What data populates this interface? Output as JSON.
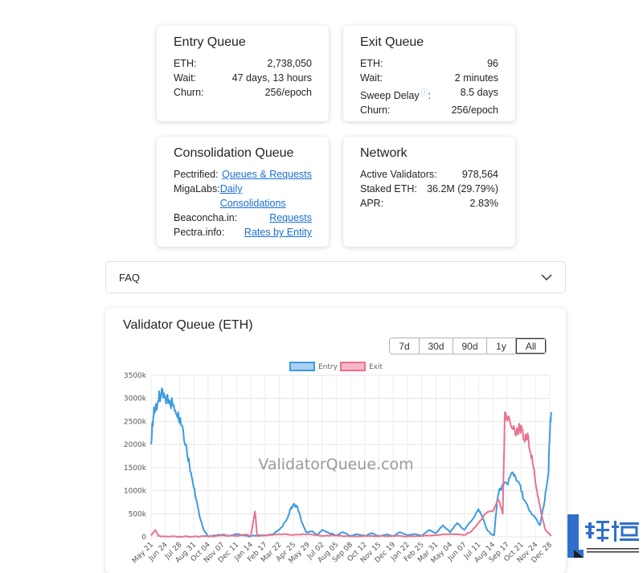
{
  "cards": {
    "entry": {
      "title": "Entry Queue",
      "rows": [
        {
          "key": "ETH:",
          "value": "2,738,050"
        },
        {
          "key": "Wait:",
          "value": "47 days, 13 hours"
        },
        {
          "key": "Churn:",
          "value": "256/epoch"
        }
      ]
    },
    "exit": {
      "title": "Exit Queue",
      "rows": [
        {
          "key": "ETH:",
          "value": "96"
        },
        {
          "key": "Wait:",
          "value": "2 minutes"
        },
        {
          "key": "Sweep Delay",
          "colon": ":",
          "value": "8.5 days",
          "info_icon": "info-circle-icon"
        },
        {
          "key": "Churn:",
          "value": "256/epoch"
        }
      ]
    },
    "consolidation": {
      "title": "Consolidation Queue",
      "rows": [
        {
          "key": "Pectrified:",
          "link": "Queues & Requests"
        },
        {
          "key": "MigaLabs:",
          "link_line1": "Daily",
          "link_line2": "Consolidations"
        },
        {
          "key": "Beaconcha.in:",
          "link": "Requests"
        },
        {
          "key": "Pectra.info:",
          "link": "Rates by Entity"
        }
      ]
    },
    "network": {
      "title": "Network",
      "rows": [
        {
          "key": "Active Validators:",
          "value": "978,564"
        },
        {
          "key": "Staked ETH:",
          "value": "36.2M (29.79%)"
        },
        {
          "key": "APR:",
          "value": "2.83%"
        }
      ]
    }
  },
  "faq": {
    "label": "FAQ",
    "icon": "chevron-down-icon"
  },
  "chart_card": {
    "title": "Validator Queue (ETH)",
    "ranges": [
      "7d",
      "30d",
      "90d",
      "1y",
      "All"
    ],
    "active_range": "All"
  },
  "chart_data": {
    "type": "line",
    "title": "",
    "watermark": "ValidatorQueue.com",
    "xlabel": "",
    "ylabel": "",
    "ylim": [
      0,
      3500000
    ],
    "ytick_labels": [
      "0",
      "500k",
      "1000k",
      "1500k",
      "2000k",
      "2500k",
      "3000k",
      "3500k"
    ],
    "xtick_labels": [
      "May 21",
      "Jun 24",
      "Jul 28",
      "Aug 31",
      "Oct 04",
      "Nov 07",
      "Dec 11",
      "Jan 14",
      "Feb 17",
      "Mar 22",
      "Apr 25",
      "May 29",
      "Jul 02",
      "Aug 05",
      "Sep 08",
      "Oct 12",
      "Nov 15",
      "Dec 19",
      "Jan 22",
      "Feb 25",
      "Mar 31",
      "May 04",
      "Jun 07",
      "Jul 11",
      "Aug 14",
      "Sep 17",
      "Oct 21",
      "Nov 24",
      "Dec 28"
    ],
    "legend": {
      "placement": "top-center"
    },
    "grid": true,
    "series": [
      {
        "name": "Entry",
        "color": "#3d9be0",
        "values": [
          [
            0,
            2000000
          ],
          [
            0.15,
            2600000
          ],
          [
            0.3,
            2800000
          ],
          [
            0.5,
            2950000
          ],
          [
            0.7,
            3050000
          ],
          [
            1.0,
            3000000
          ],
          [
            1.3,
            2950000
          ],
          [
            1.6,
            2850000
          ],
          [
            1.9,
            2700000
          ],
          [
            2.2,
            2400000
          ],
          [
            2.5,
            1900000
          ],
          [
            2.8,
            1400000
          ],
          [
            3.1,
            900000
          ],
          [
            3.4,
            450000
          ],
          [
            3.7,
            150000
          ],
          [
            4.0,
            10000
          ],
          [
            4.5,
            30000
          ],
          [
            5.0,
            50000
          ],
          [
            5.5,
            20000
          ],
          [
            6.0,
            60000
          ],
          [
            6.5,
            30000
          ],
          [
            7.0,
            10000
          ],
          [
            7.5,
            40000
          ],
          [
            8.0,
            30000
          ],
          [
            8.5,
            50000
          ],
          [
            9.0,
            150000
          ],
          [
            9.5,
            350000
          ],
          [
            9.8,
            600000
          ],
          [
            10.0,
            700000
          ],
          [
            10.3,
            620000
          ],
          [
            10.6,
            300000
          ],
          [
            10.9,
            100000
          ],
          [
            11.3,
            120000
          ],
          [
            11.7,
            40000
          ],
          [
            12.0,
            150000
          ],
          [
            12.5,
            80000
          ],
          [
            13.0,
            30000
          ],
          [
            13.5,
            100000
          ],
          [
            14.0,
            20000
          ],
          [
            14.5,
            60000
          ],
          [
            15.0,
            20000
          ],
          [
            15.5,
            80000
          ],
          [
            16.0,
            10000
          ],
          [
            16.5,
            50000
          ],
          [
            17.0,
            20000
          ],
          [
            17.5,
            100000
          ],
          [
            18.0,
            30000
          ],
          [
            18.5,
            60000
          ],
          [
            19.0,
            20000
          ],
          [
            19.5,
            150000
          ],
          [
            20.0,
            80000
          ],
          [
            20.5,
            250000
          ],
          [
            21.0,
            100000
          ],
          [
            21.5,
            300000
          ],
          [
            22.0,
            150000
          ],
          [
            22.5,
            350000
          ],
          [
            23.0,
            600000
          ],
          [
            23.3,
            400000
          ],
          [
            23.6,
            150000
          ],
          [
            23.9,
            50000
          ],
          [
            24.1,
            40000
          ],
          [
            24.3,
            800000
          ],
          [
            24.5,
            1050000
          ],
          [
            25.0,
            1150000
          ],
          [
            25.4,
            1400000
          ],
          [
            25.8,
            1200000
          ],
          [
            26.2,
            800000
          ],
          [
            26.6,
            550000
          ],
          [
            27.0,
            400000
          ],
          [
            27.3,
            250000
          ],
          [
            27.6,
            700000
          ],
          [
            27.9,
            1350000
          ],
          [
            28.0,
            2200000
          ],
          [
            28.1,
            2700000
          ]
        ]
      },
      {
        "name": "Exit",
        "color": "#e8728e",
        "values": [
          [
            0,
            30000
          ],
          [
            0.3,
            150000
          ],
          [
            0.5,
            20000
          ],
          [
            1.0,
            10000
          ],
          [
            2.0,
            5000
          ],
          [
            3.0,
            5000
          ],
          [
            4.0,
            10000
          ],
          [
            5.0,
            30000
          ],
          [
            6.0,
            20000
          ],
          [
            6.7,
            50000
          ],
          [
            7.0,
            10000
          ],
          [
            7.3,
            550000
          ],
          [
            7.45,
            20000
          ],
          [
            8.0,
            30000
          ],
          [
            9.0,
            60000
          ],
          [
            10.0,
            40000
          ],
          [
            11.0,
            60000
          ],
          [
            12.0,
            20000
          ],
          [
            13.0,
            30000
          ],
          [
            14.0,
            10000
          ],
          [
            15.0,
            20000
          ],
          [
            16.0,
            10000
          ],
          [
            17.0,
            20000
          ],
          [
            18.0,
            10000
          ],
          [
            19.0,
            20000
          ],
          [
            20.0,
            40000
          ],
          [
            21.0,
            60000
          ],
          [
            22.0,
            40000
          ],
          [
            22.5,
            120000
          ],
          [
            23.0,
            300000
          ],
          [
            23.5,
            500000
          ],
          [
            24.0,
            550000
          ],
          [
            24.4,
            800000
          ],
          [
            24.7,
            500000
          ],
          [
            24.85,
            2700000
          ],
          [
            25.2,
            2500000
          ],
          [
            25.6,
            2200000
          ],
          [
            25.9,
            2400000
          ],
          [
            26.2,
            2100000
          ],
          [
            26.5,
            2150000
          ],
          [
            26.8,
            1600000
          ],
          [
            27.1,
            1000000
          ],
          [
            27.4,
            500000
          ],
          [
            27.7,
            150000
          ],
          [
            27.9,
            80000
          ],
          [
            28.1,
            20000
          ]
        ]
      }
    ]
  },
  "site_logo": {
    "text_cn": "链懂",
    "text_en": "NEATDOWN.COM",
    "icon": "neatdown-logo-icon"
  }
}
